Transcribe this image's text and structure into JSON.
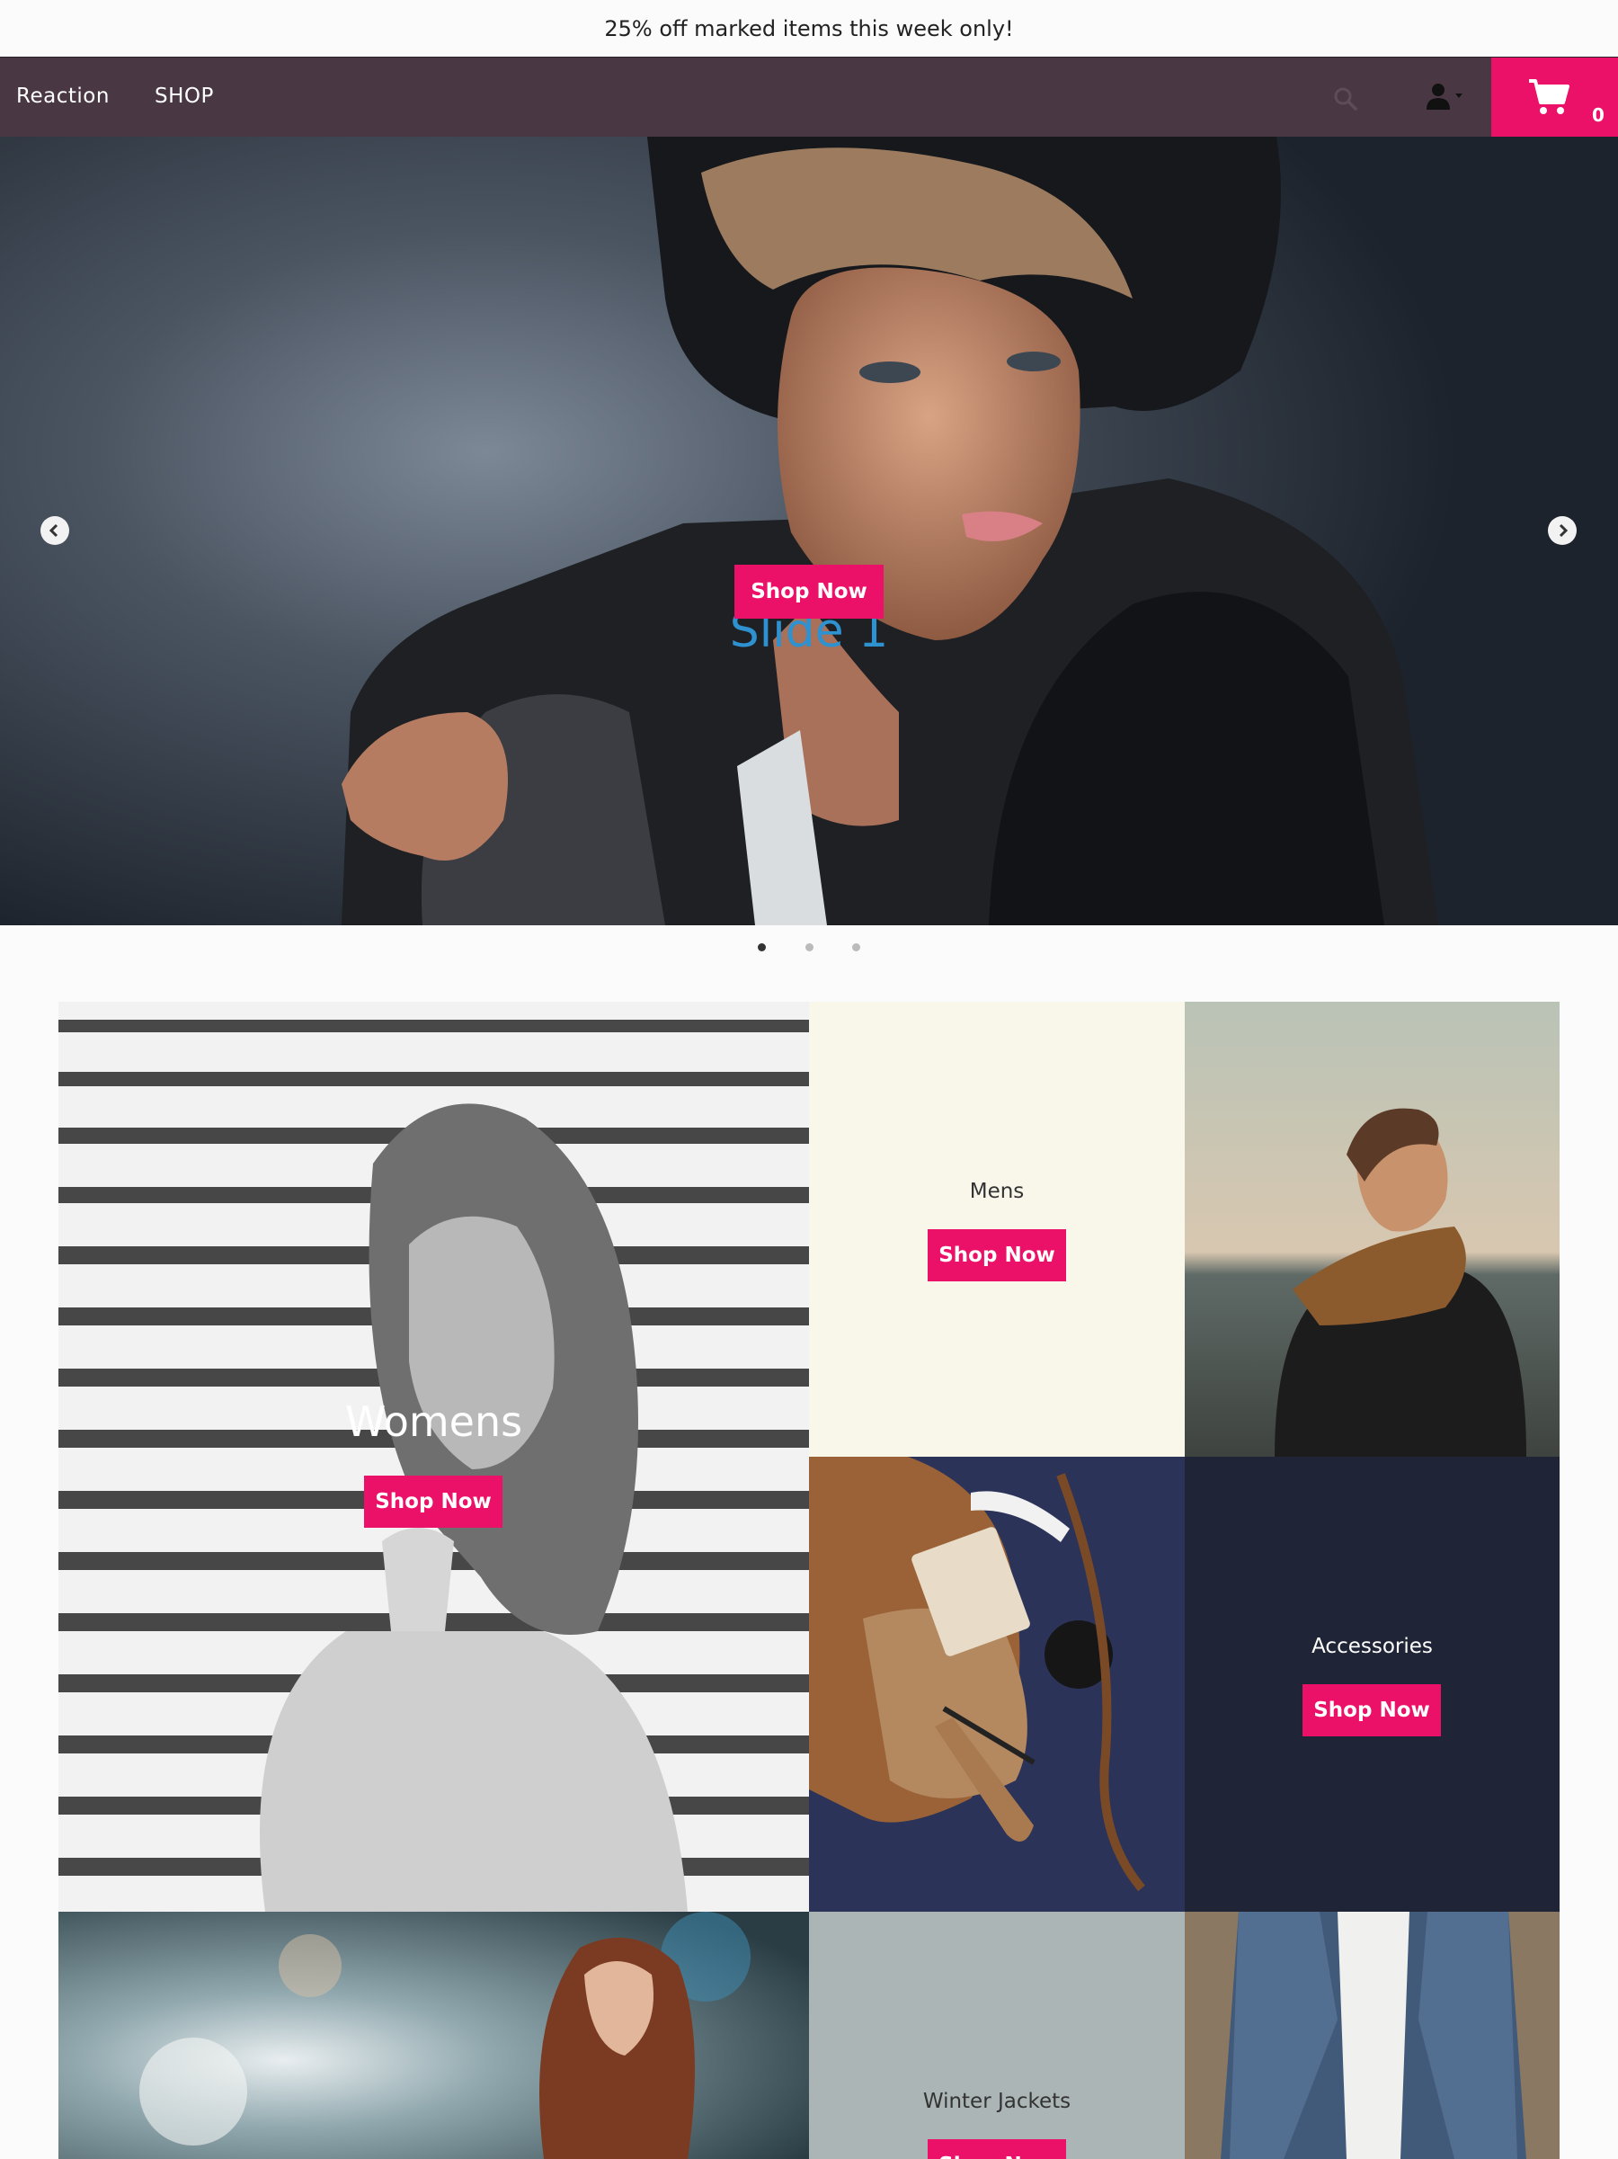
{
  "promo": {
    "text": "25% off marked items this week only!"
  },
  "nav": {
    "brand": "Reaction",
    "shop": "SHOP",
    "cart_count": "0"
  },
  "hero": {
    "title": "Slide 1",
    "button": "Shop Now",
    "slide_count": 3,
    "active_slide": 1
  },
  "categories": [
    {
      "label": "Womens",
      "button": "Shop Now"
    },
    {
      "label": "Mens",
      "button": "Shop Now"
    },
    {
      "label": "Accessories",
      "button": "Shop Now"
    },
    {
      "label": "Winter Jackets",
      "button": "Shop Now"
    }
  ],
  "colors": {
    "nav_bg": "#493843",
    "accent": "#ec1168",
    "hero_title": "#2e91d0",
    "mens_bg": "#f9f6ea",
    "accessories_bg": "#1f2436",
    "winter_bg": "#abb5b5"
  }
}
